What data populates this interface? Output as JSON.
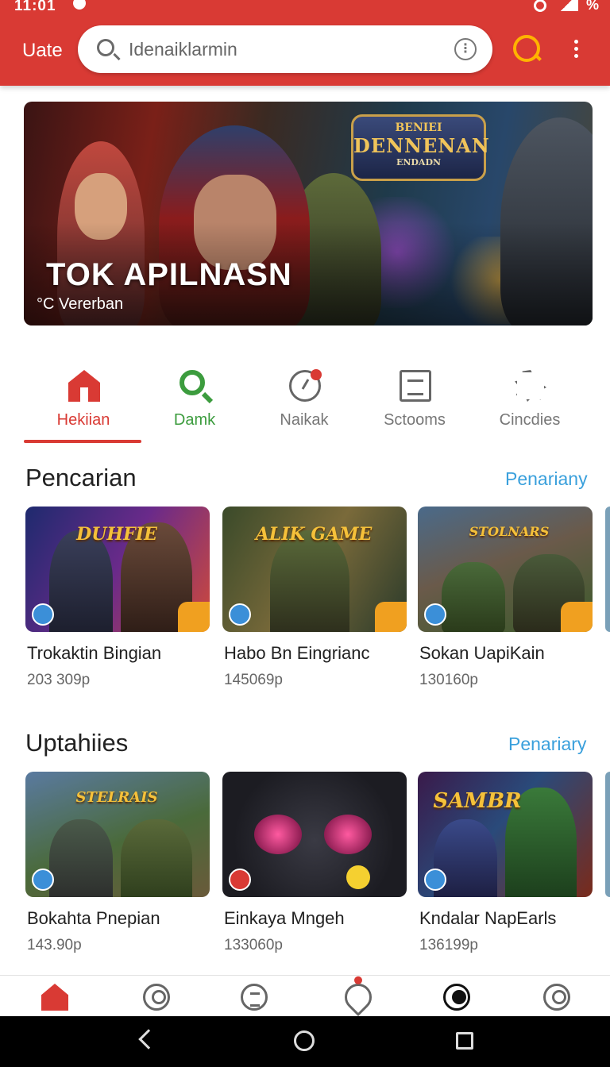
{
  "status_bar": {
    "time": "11:01",
    "battery": "%"
  },
  "app_bar": {
    "title": "Uate",
    "search_text": "Idenaiklarmin",
    "icons": [
      "search-icon",
      "info-icon",
      "account-search-icon",
      "more-vert-icon"
    ]
  },
  "hero": {
    "badge_line1": "BENIEI",
    "badge_line2": "DENNENAN",
    "badge_line3": "ENDADN",
    "title": "TOK APILNASN",
    "subtitle": "Vererban"
  },
  "tabs": [
    {
      "label": "Hekiian",
      "icon": "home-icon",
      "active": true
    },
    {
      "label": "Damk",
      "icon": "search-icon"
    },
    {
      "label": "Naikak",
      "icon": "clock-icon"
    },
    {
      "label": "Sctooms",
      "icon": "document-icon"
    },
    {
      "label": "Cincdies",
      "icon": "gear-icon"
    }
  ],
  "section1": {
    "title": "Pencarian",
    "link": "Penariany",
    "items": [
      {
        "name": "Trokaktin Bingian",
        "meta": "203 309p",
        "logo": "DUHFIE"
      },
      {
        "name": "Habo Bn Eingrianc",
        "meta": "145069p",
        "logo": "ALIK GAME"
      },
      {
        "name": "Sokan UapiKain",
        "meta": "130160p",
        "logo": "STOLNARS"
      }
    ]
  },
  "section2": {
    "title": "Uptahiies",
    "link": "Penariary",
    "items": [
      {
        "name": "Bokahta Pnepian",
        "meta": "143.90p",
        "logo": "STELRAIS"
      },
      {
        "name": "Einkaya Mngeh",
        "meta": "133060p",
        "logo": ""
      },
      {
        "name": "Kndalar NapEarls",
        "meta": "136199p",
        "logo": "SAMBR"
      }
    ]
  },
  "bottom_nav": [
    "home-icon",
    "profile-icon",
    "menu-circle-icon",
    "chat-icon",
    "account-icon",
    "profile-icon"
  ],
  "colors": {
    "primary": "#d93a34",
    "link": "#3aa0dc",
    "active_green": "#3c9c3e"
  }
}
